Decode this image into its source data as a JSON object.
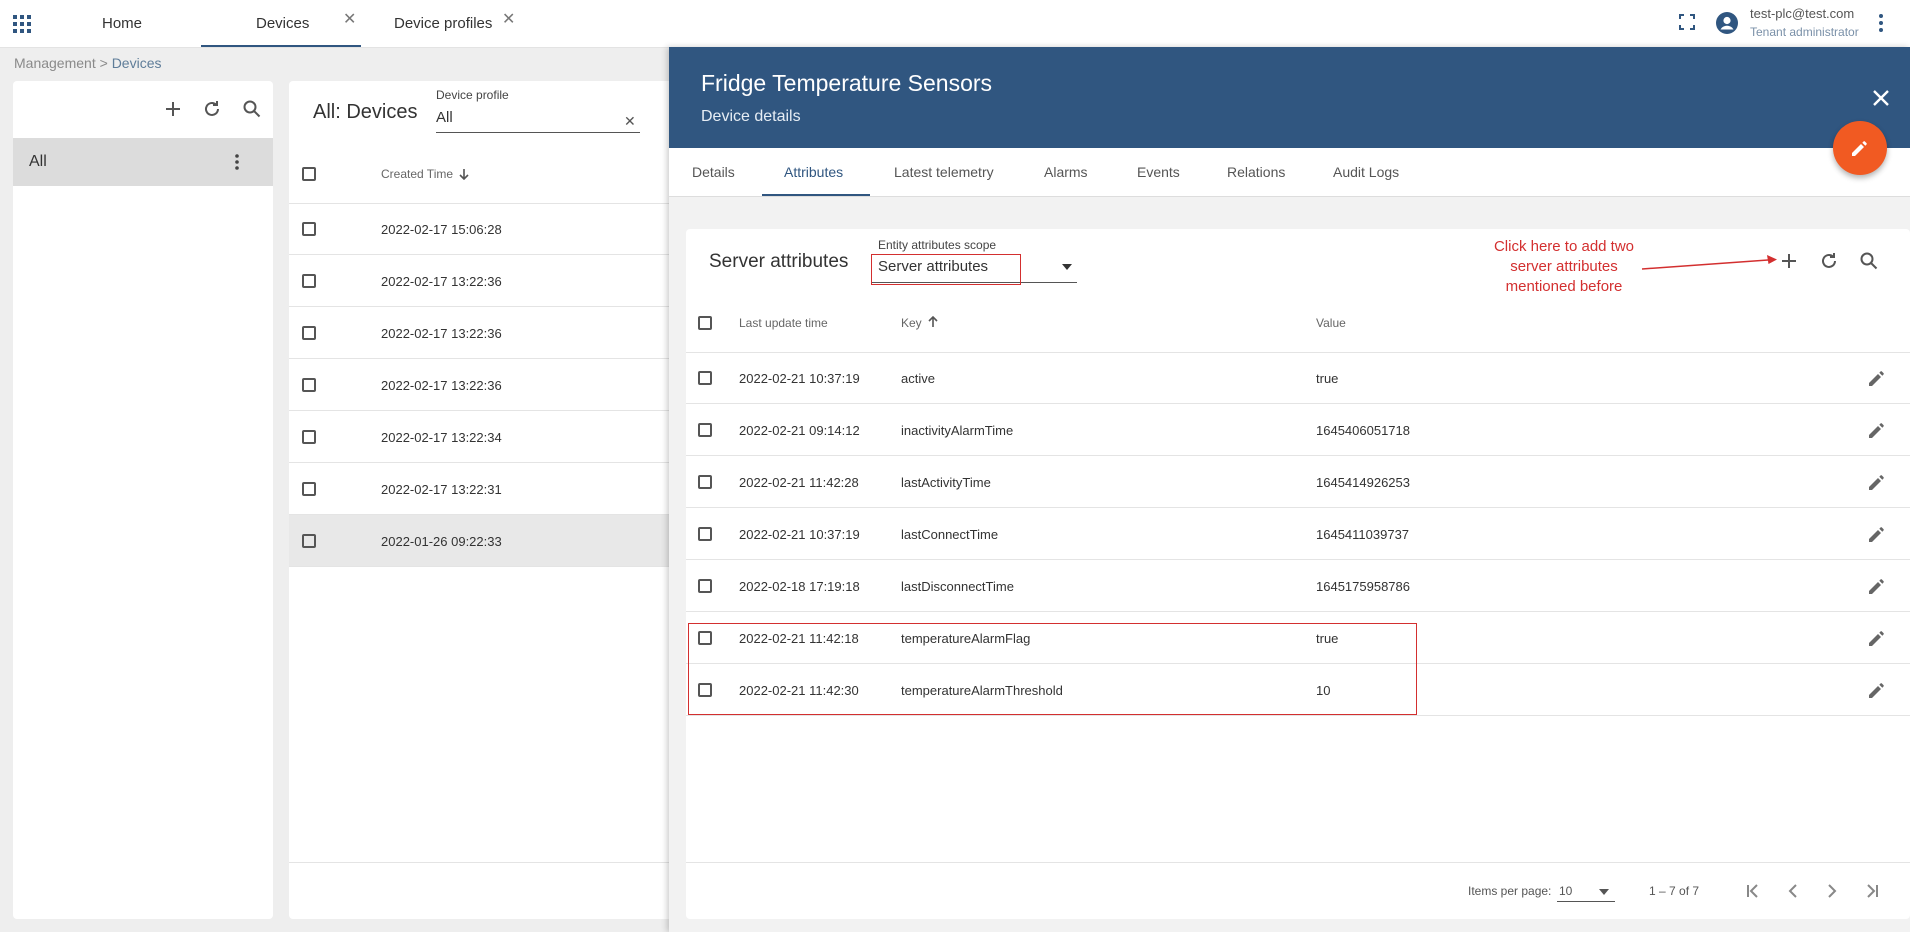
{
  "topbar": {
    "tabs": [
      {
        "label": "Home"
      },
      {
        "label": "Devices"
      },
      {
        "label": "Device profiles"
      }
    ],
    "user_email": "test-plc@test.com",
    "user_role": "Tenant administrator"
  },
  "breadcrumb": {
    "parent": "Management",
    "separator": ">",
    "current": "Devices"
  },
  "left_panel": {
    "group_label": "All"
  },
  "devices_panel": {
    "title": "All: Devices",
    "profile_label": "Device profile",
    "profile_value": "All",
    "column_created": "Created Time",
    "rows": [
      {
        "created": "2022-02-17 15:06:28"
      },
      {
        "created": "2022-02-17 13:22:36"
      },
      {
        "created": "2022-02-17 13:22:36"
      },
      {
        "created": "2022-02-17 13:22:36"
      },
      {
        "created": "2022-02-17 13:22:34"
      },
      {
        "created": "2022-02-17 13:22:31"
      },
      {
        "created": "2022-01-26 09:22:33"
      }
    ]
  },
  "details": {
    "title": "Fridge Temperature Sensors",
    "subtitle": "Device details",
    "tabs": [
      {
        "label": "Details"
      },
      {
        "label": "Attributes"
      },
      {
        "label": "Latest telemetry"
      },
      {
        "label": "Alarms"
      },
      {
        "label": "Events"
      },
      {
        "label": "Relations"
      },
      {
        "label": "Audit Logs"
      }
    ],
    "active_tab": "Attributes"
  },
  "attributes": {
    "title": "Server attributes",
    "scope_label": "Entity attributes scope",
    "scope_value": "Server attributes",
    "annotation": "Click here to add two server attributes mentioned before",
    "columns": {
      "time": "Last update time",
      "key": "Key",
      "value": "Value"
    },
    "rows": [
      {
        "time": "2022-02-21 10:37:19",
        "key": "active",
        "value": "true"
      },
      {
        "time": "2022-02-21 09:14:12",
        "key": "inactivityAlarmTime",
        "value": "1645406051718"
      },
      {
        "time": "2022-02-21 11:42:28",
        "key": "lastActivityTime",
        "value": "1645414926253"
      },
      {
        "time": "2022-02-21 10:37:19",
        "key": "lastConnectTime",
        "value": "1645411039737"
      },
      {
        "time": "2022-02-18 17:19:18",
        "key": "lastDisconnectTime",
        "value": "1645175958786"
      },
      {
        "time": "2022-02-21 11:42:18",
        "key": "temperatureAlarmFlag",
        "value": "true"
      },
      {
        "time": "2022-02-21 11:42:30",
        "key": "temperatureAlarmThreshold",
        "value": "10"
      }
    ],
    "footer": {
      "items_per_page_label": "Items per page:",
      "items_per_page": "10",
      "range": "1 – 7 of 7"
    }
  },
  "colors": {
    "header_blue": "#305680",
    "fab_orange": "#f15a22",
    "annotation_red": "#d32f2f"
  },
  "icons": [
    "apps-icon",
    "close-icon",
    "fullscreen-icon",
    "account-icon",
    "more-vert-icon",
    "add-icon",
    "refresh-icon",
    "search-icon",
    "arrow-down-icon",
    "arrow-up-icon",
    "dropdown-icon",
    "edit-icon",
    "first-page-icon",
    "chevron-left-icon",
    "chevron-right-icon",
    "last-page-icon"
  ]
}
